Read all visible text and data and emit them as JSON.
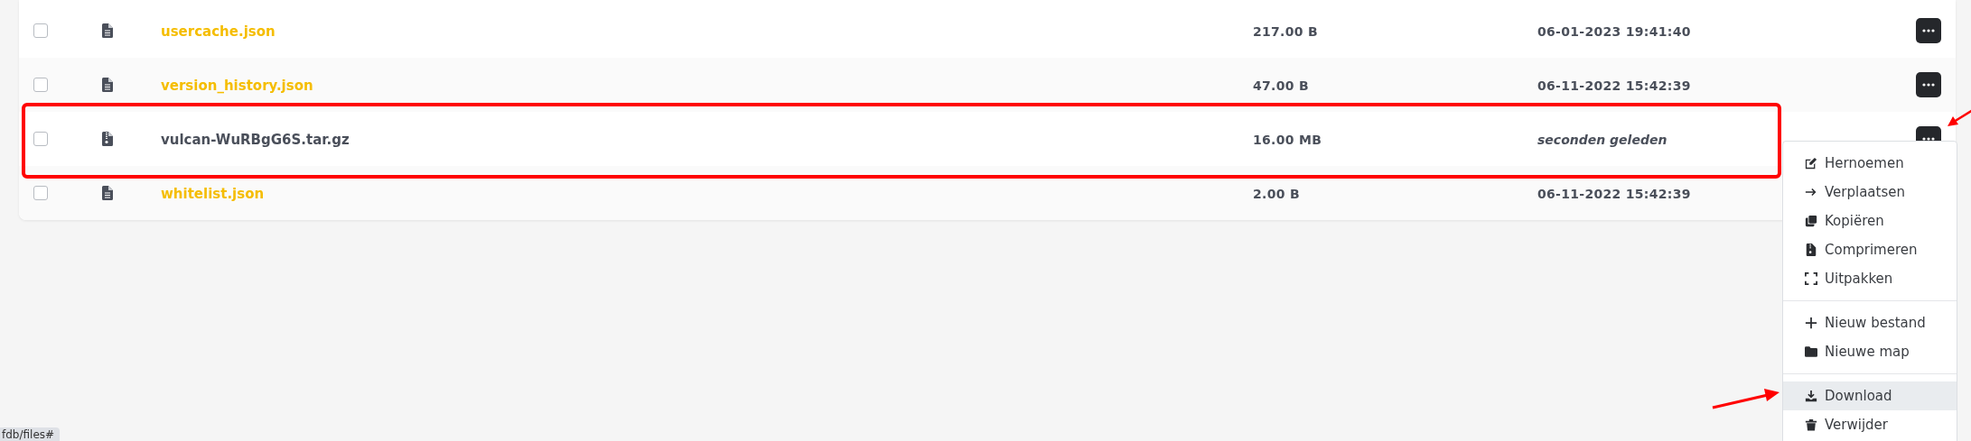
{
  "files": [
    {
      "name": "usercache.json",
      "kind": "file",
      "new": false,
      "size": "217.00 B",
      "modified": "06-01-2023 19:41:40",
      "checked": false,
      "menu_button": true
    },
    {
      "name": "version_history.json",
      "kind": "file",
      "new": false,
      "size": "47.00 B",
      "modified": "06-11-2022 15:42:39",
      "checked": false,
      "menu_button": true
    },
    {
      "name": "vulcan-WuRBgG6S.tar.gz",
      "kind": "archive",
      "new": true,
      "size": "16.00 MB",
      "modified": "seconden geleden",
      "checked": false,
      "menu_button": true
    },
    {
      "name": "whitelist.json",
      "kind": "file",
      "new": false,
      "size": "2.00 B",
      "modified": "06-11-2022 15:42:39",
      "checked": false,
      "menu_button": false
    }
  ],
  "context_menu": {
    "groups": [
      [
        {
          "label": "Hernoemen",
          "kind": "edit",
          "hovered": false
        },
        {
          "label": "Verplaatsen",
          "kind": "move",
          "hovered": false
        },
        {
          "label": "Kopiëren",
          "kind": "copy",
          "hovered": false
        },
        {
          "label": "Comprimeren",
          "kind": "compress",
          "hovered": false
        },
        {
          "label": "Uitpakken",
          "kind": "extract",
          "hovered": false
        }
      ],
      [
        {
          "label": "Nieuw bestand",
          "kind": "new-file",
          "hovered": false
        },
        {
          "label": "Nieuwe map",
          "kind": "folder",
          "hovered": false
        }
      ],
      [
        {
          "label": "Download",
          "kind": "download",
          "hovered": true
        },
        {
          "label": "Verwijder",
          "kind": "delete",
          "hovered": false
        }
      ]
    ]
  },
  "annotations": [
    {
      "kind": "frame"
    },
    {
      "kind": "arrow"
    },
    {
      "kind": "arrow"
    }
  ],
  "status_url": "fdb/files#"
}
